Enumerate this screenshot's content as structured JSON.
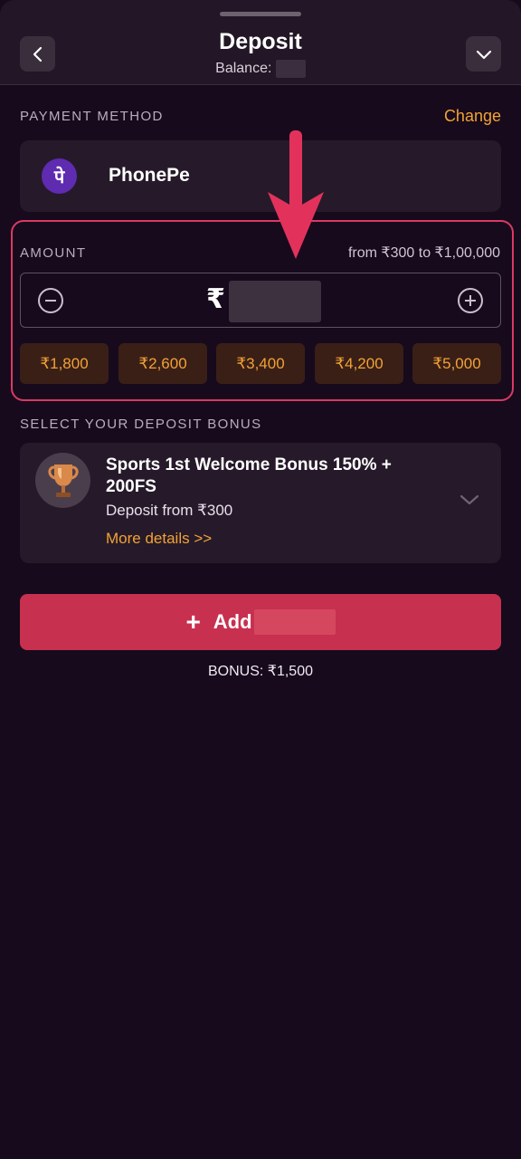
{
  "header": {
    "title": "Deposit",
    "balance_label": "Balance:"
  },
  "payment": {
    "section_label": "PAYMENT METHOD",
    "change_label": "Change",
    "method_name": "PhonePe",
    "method_logo_text": "पे"
  },
  "amount": {
    "section_label": "AMOUNT",
    "range": "from ₹300 to ₹1,00,000",
    "currency_symbol": "₹",
    "chips": [
      "₹1,800",
      "₹2,600",
      "₹3,400",
      "₹4,200",
      "₹5,000"
    ]
  },
  "bonus": {
    "section_label": "SELECT YOUR DEPOSIT BONUS",
    "title": "Sports 1st Welcome Bonus 150% + 200FS",
    "subtitle": "Deposit from ₹300",
    "more": "More details >>"
  },
  "action": {
    "add_label": "Add",
    "bonus_total": "BONUS: ₹1,500"
  },
  "colors": {
    "background": "#170a1c",
    "accent": "#c8304f",
    "highlight": "#f2a234",
    "annotation": "#d93a63"
  }
}
